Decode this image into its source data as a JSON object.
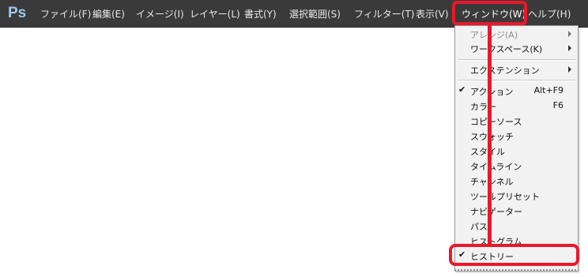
{
  "app": {
    "logo": "Ps"
  },
  "menubar": {
    "items": [
      {
        "label": "ファイル(F)"
      },
      {
        "label": "編集(E)"
      },
      {
        "label": "イメージ(I)"
      },
      {
        "label": "レイヤー(L)"
      },
      {
        "label": "書式(Y)"
      },
      {
        "label": "選択範囲(S)"
      },
      {
        "label": "フィルター(T)"
      },
      {
        "label": "表示(V)"
      },
      {
        "label": "ウィンドウ(W)"
      },
      {
        "label": "ヘルプ(H)"
      }
    ]
  },
  "window_menu": {
    "items": [
      {
        "label": "アレンジ(A)",
        "disabled": true,
        "submenu": true
      },
      {
        "label": "ワークスペース(K)",
        "submenu": true
      },
      {
        "label": "エクステンション",
        "submenu": true
      },
      {
        "label": "アクション",
        "shortcut": "Alt+F9",
        "checked": true
      },
      {
        "label": "カラー",
        "shortcut": "F6"
      },
      {
        "label": "コピーソース"
      },
      {
        "label": "スウォッチ"
      },
      {
        "label": "スタイル"
      },
      {
        "label": "タイムライン"
      },
      {
        "label": "チャンネル"
      },
      {
        "label": "ツールプリセット"
      },
      {
        "label": "ナビゲーター"
      },
      {
        "label": "パス"
      },
      {
        "label": "ヒストグラム"
      },
      {
        "label": "ヒストリー",
        "checked": true
      }
    ],
    "check_glyph": "✔"
  },
  "colors": {
    "menubar_bg": "#3a3a3a",
    "annotation": "#e8192c",
    "logo": "#9ec8ee"
  }
}
